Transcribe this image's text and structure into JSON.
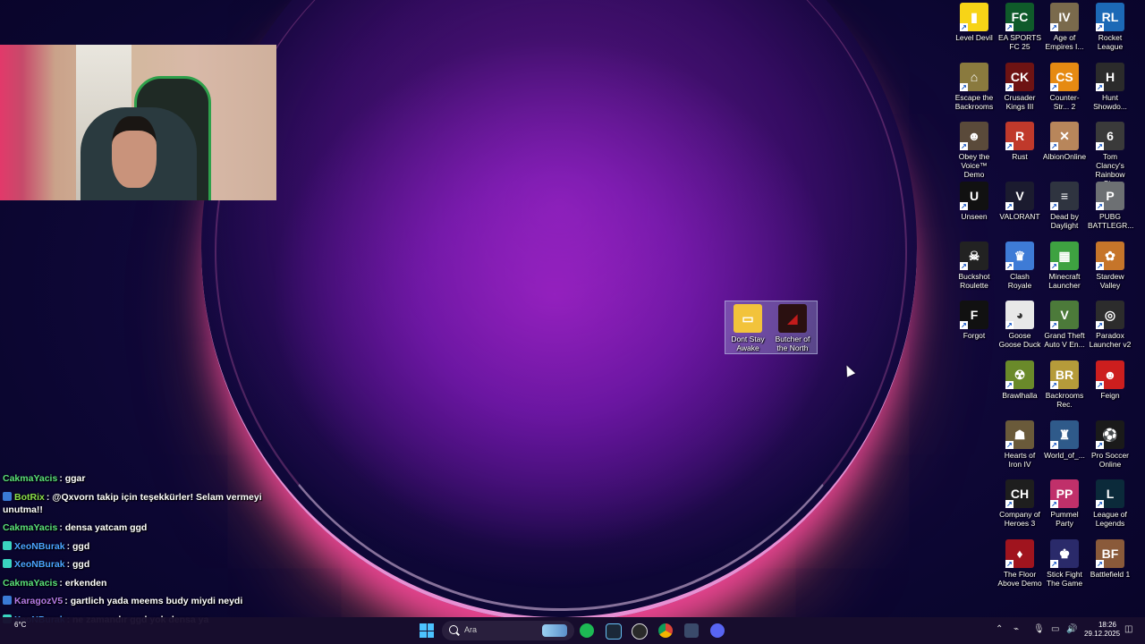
{
  "desktop": {
    "icons": [
      {
        "label": "Level Devil",
        "color": "#f7d417",
        "glyph": "▮"
      },
      {
        "label": "EA SPORTS FC 25",
        "color": "#0f5a2a",
        "glyph": "FC"
      },
      {
        "label": "Age of Empires I...",
        "color": "#7a6a4c",
        "glyph": "IV"
      },
      {
        "label": "Rocket League",
        "color": "#1c69b6",
        "glyph": "RL"
      },
      {
        "label": "Escape the Backrooms",
        "color": "#8a7a3e",
        "glyph": "⌂"
      },
      {
        "label": "Crusader Kings III",
        "color": "#6e1313",
        "glyph": "CK"
      },
      {
        "label": "Counter-Str... 2",
        "color": "#e68a12",
        "glyph": "CS"
      },
      {
        "label": "Hunt Showdo...",
        "color": "#2b2b2b",
        "glyph": "H"
      },
      {
        "label": "Obey the Voice™ Demo",
        "color": "#5a4a3a",
        "glyph": "☻"
      },
      {
        "label": "Rust",
        "color": "#c0392b",
        "glyph": "R"
      },
      {
        "label": "AlbionOnline",
        "color": "#b8865b",
        "glyph": "✕"
      },
      {
        "label": "Tom Clancy's Rainbow Si...",
        "color": "#3a3a3a",
        "glyph": "6"
      },
      {
        "label": "Unseen",
        "color": "#111111",
        "glyph": "U"
      },
      {
        "label": "VALORANT",
        "color": "#1b1b2f",
        "glyph": "V"
      },
      {
        "label": "Dead by Daylight",
        "color": "#2f3440",
        "glyph": "≡"
      },
      {
        "label": "PUBG BATTLEGR...",
        "color": "#6d7073",
        "glyph": "P"
      },
      {
        "label": "Buckshot Roulette",
        "color": "#222222",
        "glyph": "☠"
      },
      {
        "label": "Clash Royale",
        "color": "#3e7bd6",
        "glyph": "♛"
      },
      {
        "label": "Minecraft Launcher",
        "color": "#3ea241",
        "glyph": "▦"
      },
      {
        "label": "Stardew Valley",
        "color": "#c6752a",
        "glyph": "✿"
      },
      {
        "label": "Forgot",
        "color": "#111111",
        "glyph": "F"
      },
      {
        "label": "Goose Goose Duck",
        "color": "#e8e8e8",
        "glyph": "◕"
      },
      {
        "label": "Grand Theft Auto V En...",
        "color": "#4c7a3a",
        "glyph": "V"
      },
      {
        "label": "Paradox Launcher v2",
        "color": "#2c2c2c",
        "glyph": "◎"
      },
      {
        "label": "",
        "color": "",
        "glyph": ""
      },
      {
        "label": "Brawlhalla",
        "color": "#6a8a2a",
        "glyph": "☢"
      },
      {
        "label": "Backrooms Rec.",
        "color": "#b59b3a",
        "glyph": "BR"
      },
      {
        "label": "Feign",
        "color": "#cc1e1e",
        "glyph": "☻"
      },
      {
        "label": "",
        "color": "",
        "glyph": ""
      },
      {
        "label": "Hearts of Iron IV",
        "color": "#6a5a3a",
        "glyph": "☗"
      },
      {
        "label": "World_of_...",
        "color": "#2f5a8a",
        "glyph": "♜"
      },
      {
        "label": "Pro Soccer Online",
        "color": "#1a1a1a",
        "glyph": "⚽"
      },
      {
        "label": "",
        "color": "",
        "glyph": ""
      },
      {
        "label": "Company of Heroes 3",
        "color": "#1e1e1e",
        "glyph": "CH"
      },
      {
        "label": "Pummel Party",
        "color": "#c0306a",
        "glyph": "PP"
      },
      {
        "label": "League of Legends",
        "color": "#0b2a3a",
        "glyph": "L"
      },
      {
        "label": "",
        "color": "",
        "glyph": ""
      },
      {
        "label": "The Floor Above Demo",
        "color": "#a0141e",
        "glyph": "♦"
      },
      {
        "label": "Stick Fight The Game",
        "color": "#2a2a6a",
        "glyph": "♚"
      },
      {
        "label": "Battlefield 1",
        "color": "#8a5a3a",
        "glyph": "BF"
      }
    ],
    "group_icons": [
      {
        "label": "Dont Stay Awake",
        "color": "#f2c33b",
        "glyph": "▭"
      },
      {
        "label": "Butcher of the North",
        "color": "#c11b1b",
        "glyph": "◢"
      }
    ]
  },
  "chat": {
    "lines": [
      {
        "user": "CakmaYacis",
        "user_color": "#5ae07a",
        "text": ": ggar",
        "badge": ""
      },
      {
        "user": "BotRix",
        "user_color": "#8be04a",
        "text": ": @Qxvorn takip için teşekkürler! Selam vermeyi unutma!!",
        "badge": "#3a7bd5"
      },
      {
        "user": "CakmaYacis",
        "user_color": "#5ae07a",
        "text": ": densa yatcam ggd",
        "badge": ""
      },
      {
        "user": "XeoNBurak",
        "user_color": "#4aa3ff",
        "text": ": ggd",
        "badge": "#3ad5c0"
      },
      {
        "user": "XeoNBurak",
        "user_color": "#4aa3ff",
        "text": ": ggd",
        "badge": "#3ad5c0"
      },
      {
        "user": "CakmaYacis",
        "user_color": "#5ae07a",
        "text": ": erkenden",
        "badge": ""
      },
      {
        "user": "KaragozV5",
        "user_color": "#b67be8",
        "text": ": gartlich yada meems budy miydi neydi",
        "badge": "#3a7bd5"
      },
      {
        "user": "XeoNBurak",
        "user_color": "#4aa3ff",
        "text": ": ne zamandır ggd yok densa ya",
        "badge": "#3ad5c0"
      }
    ]
  },
  "taskbar": {
    "search_placeholder": "Ara",
    "weather": "6°C",
    "time": "18:26",
    "date": "29.12.2025"
  }
}
